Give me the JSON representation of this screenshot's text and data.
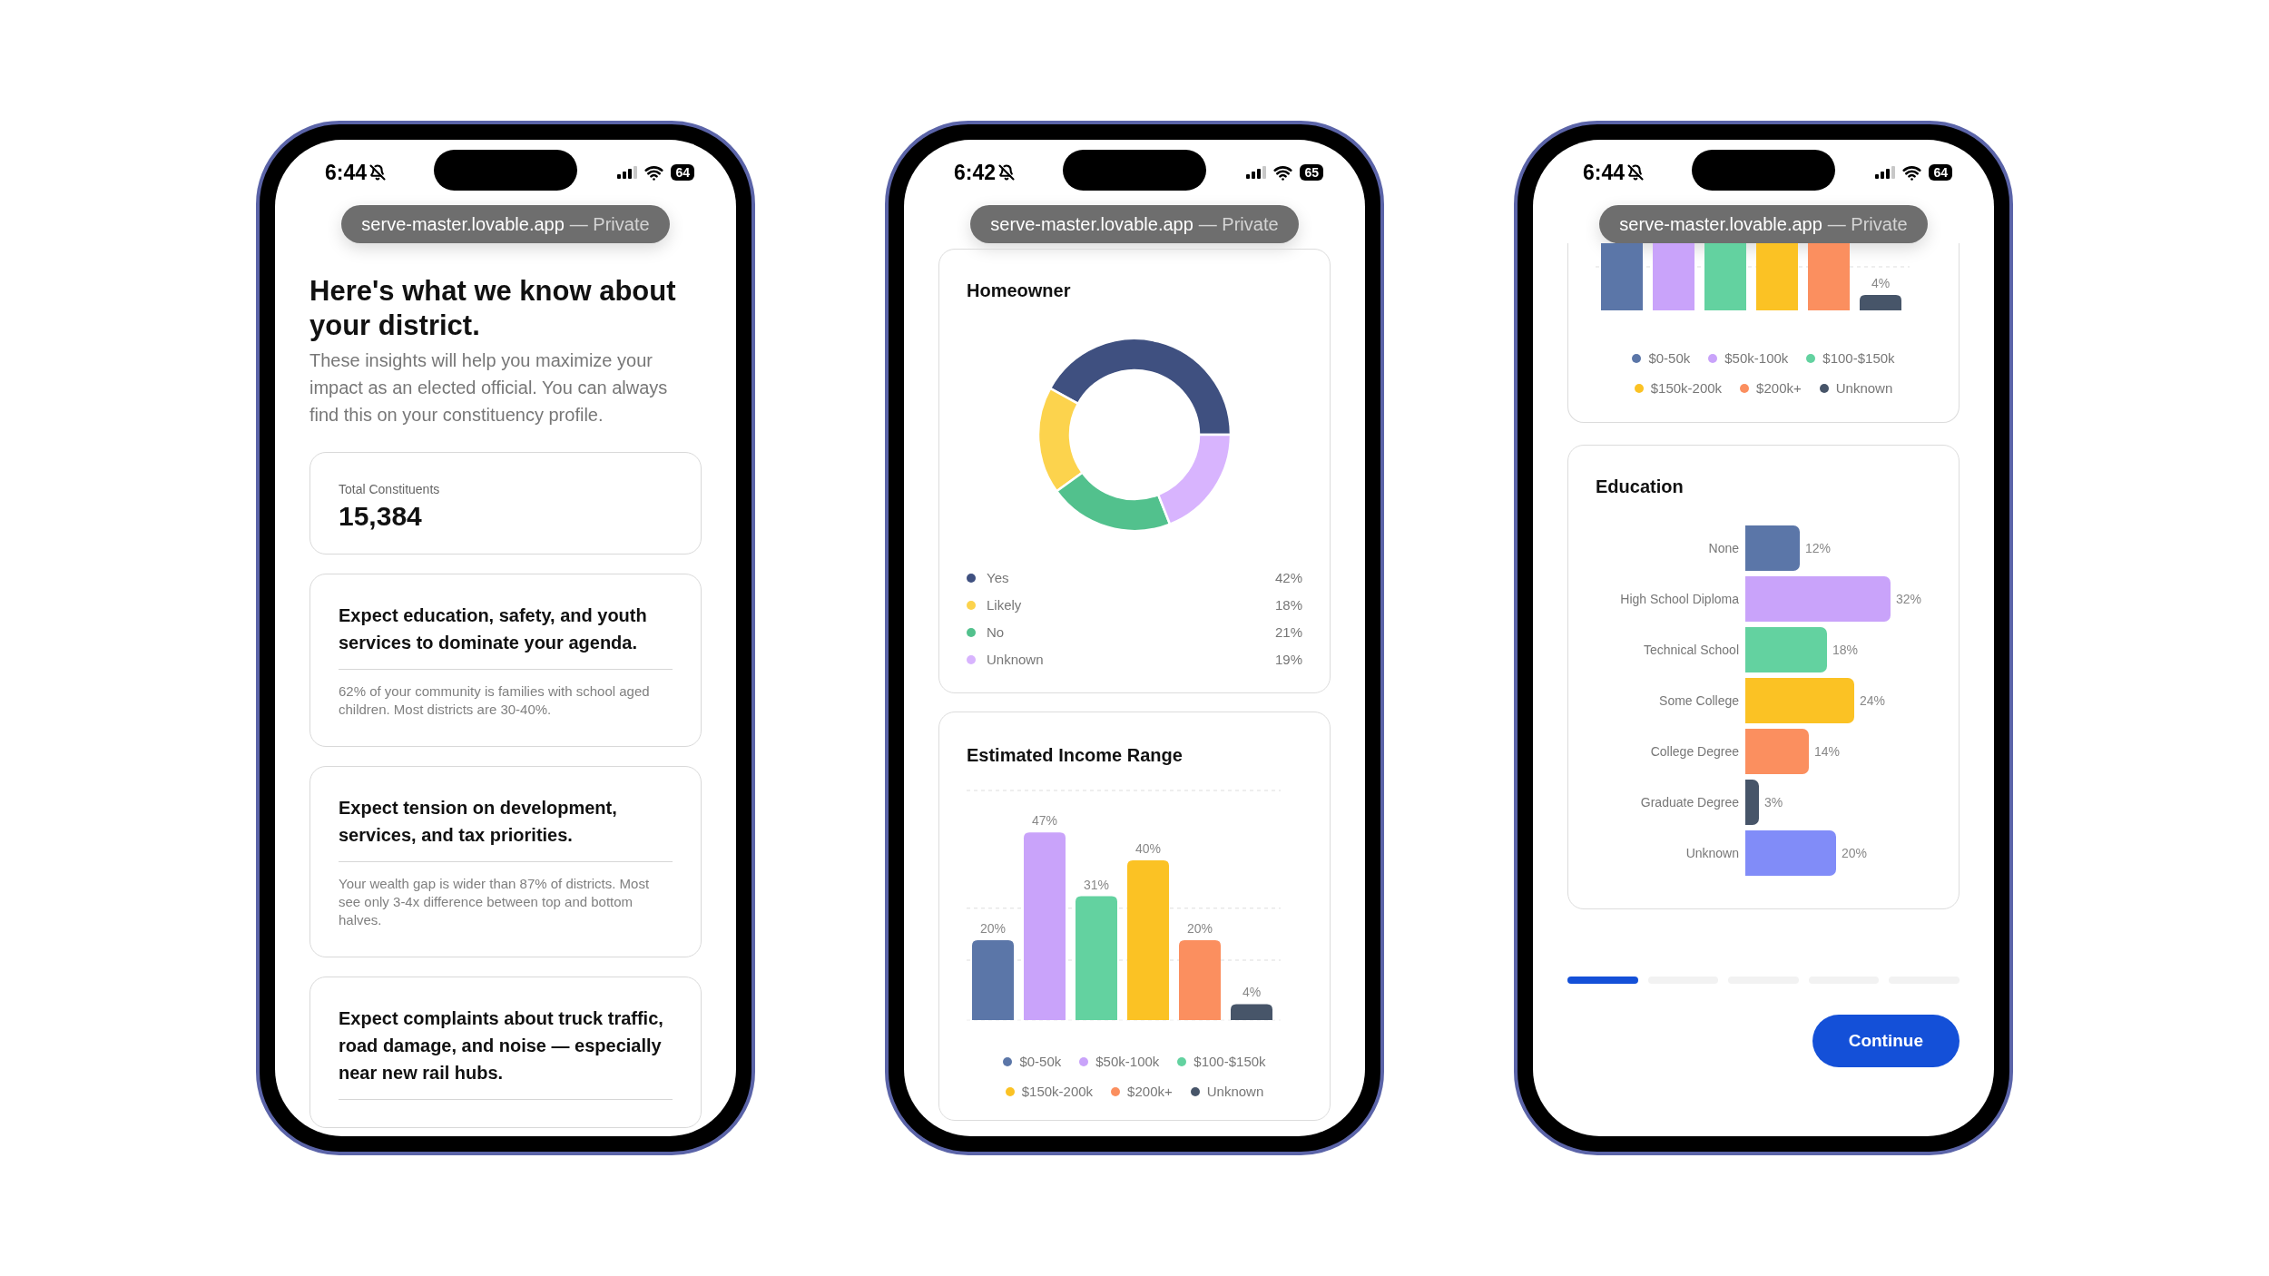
{
  "phones": [
    {
      "kind": "insights",
      "status": {
        "time": "6:44",
        "battery": "64"
      },
      "address_bar": {
        "url": "serve-master.lovable.app",
        "suffix": "— Private"
      },
      "heading": "Here's what we know about your district.",
      "intro": "These insights will help you maximize your impact as an elected official. You can always find this on your constituency profile.",
      "stat_card": {
        "label": "Total Constituents",
        "value": "15,384"
      },
      "insights": [
        {
          "headline": "Expect education, safety, and youth services to dominate your agenda.",
          "detail": "62% of your community is families with school aged children. Most districts are 30-40%."
        },
        {
          "headline": "Expect tension on development, services, and tax priorities.",
          "detail": "Your wealth gap is wider than 87% of districts. Most see only 3-4x difference between top and bottom halves."
        },
        {
          "headline": "Expect complaints about truck traffic, road damage, and noise — especially near new rail hubs."
        }
      ]
    },
    {
      "kind": "charts",
      "status": {
        "time": "6:42",
        "battery": "65"
      },
      "address_bar": {
        "url": "serve-master.lovable.app",
        "suffix": "— Private"
      },
      "homeowner": {
        "chart_data": {
          "type": "donut",
          "title": "Homeowner",
          "categories": [
            "Yes",
            "Likely",
            "No",
            "Unknown"
          ],
          "values": [
            42,
            18,
            21,
            19
          ],
          "value_labels": [
            "42%",
            "18%",
            "21%",
            "19%"
          ],
          "colors": [
            "#3f5080",
            "#fcd34d",
            "#52c18d",
            "#d8b4fe"
          ]
        }
      },
      "income": {
        "chart_data": {
          "type": "bar",
          "title": "Estimated Income Range",
          "series": [
            {
              "name": "$0-50k",
              "color": "#5b76a8",
              "values": [
                20
              ],
              "value_labels": [
                "20%"
              ]
            },
            {
              "name": "$50k-100k",
              "color": "#c9a3fa",
              "values": [
                47
              ],
              "value_labels": [
                "47%"
              ]
            },
            {
              "name": "$100-$150k",
              "color": "#63d2a0",
              "values": [
                31
              ],
              "value_labels": [
                "31%"
              ]
            },
            {
              "name": "$150k-200k",
              "color": "#fbc224",
              "values": [
                40
              ],
              "value_labels": [
                "40%"
              ]
            },
            {
              "name": "$200k+",
              "color": "#fb8f5f",
              "values": [
                20
              ],
              "value_labels": [
                "20%"
              ]
            },
            {
              "name": "Unknown",
              "color": "#475569",
              "values": [
                4
              ],
              "value_labels": [
                "4%"
              ]
            }
          ]
        }
      }
    },
    {
      "kind": "education",
      "status": {
        "time": "6:44",
        "battery": "64"
      },
      "address_bar": {
        "url": "serve-master.lovable.app",
        "suffix": "— Private"
      },
      "income_partial": {
        "bars": [
          {
            "color": "#5b76a8"
          },
          {
            "color": "#c9a3fa"
          },
          {
            "color": "#63d2a0"
          },
          {
            "color": "#fbc224"
          },
          {
            "color": "#fb8f5f"
          },
          {
            "color": "#475569",
            "label": "4%"
          }
        ],
        "legend": [
          {
            "label": "$0-50k",
            "color": "#5b76a8"
          },
          {
            "label": "$50k-100k",
            "color": "#c9a3fa"
          },
          {
            "label": "$100-$150k",
            "color": "#63d2a0"
          },
          {
            "label": "$150k-200k",
            "color": "#fbc224"
          },
          {
            "label": "$200k+",
            "color": "#fb8f5f"
          },
          {
            "label": "Unknown",
            "color": "#475569"
          }
        ]
      },
      "education": {
        "chart_data": {
          "type": "bar",
          "orientation": "horizontal",
          "title": "Education",
          "categories": [
            "None",
            "High School Diploma",
            "Technical School",
            "Some College",
            "College Degree",
            "Graduate Degree",
            "Unknown"
          ],
          "values": [
            12,
            32,
            18,
            24,
            14,
            3,
            20
          ],
          "value_labels": [
            "12%",
            "32%",
            "18%",
            "24%",
            "14%",
            "3%",
            "20%"
          ],
          "colors": [
            "#5b76a8",
            "#c9a3fa",
            "#63d2a0",
            "#fbc224",
            "#fb8f5f",
            "#475569",
            "#818cf8"
          ]
        }
      },
      "progress": [
        {
          "selected": true
        },
        {
          "selected": false
        },
        {
          "selected": false
        },
        {
          "selected": false
        },
        {
          "selected": false
        }
      ],
      "continue_button": "Continue"
    }
  ]
}
